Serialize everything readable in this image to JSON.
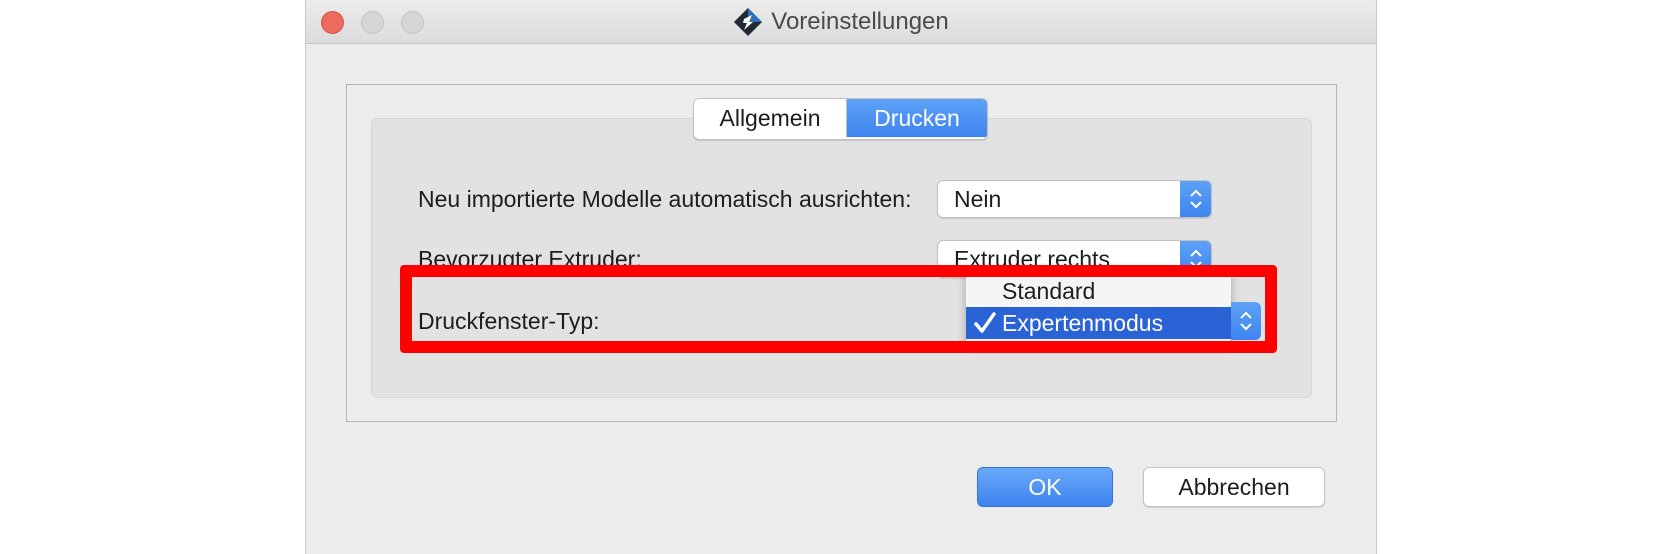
{
  "window": {
    "title": "Voreinstellungen"
  },
  "tabs": [
    {
      "label": "Allgemein",
      "selected": false
    },
    {
      "label": "Drucken",
      "selected": true
    }
  ],
  "settings": {
    "auto_align": {
      "label": "Neu importierte Modelle automatisch ausrichten:",
      "value": "Nein"
    },
    "extruder": {
      "label": "Bevorzugter Extruder:",
      "value": "Extruder rechts"
    },
    "window_type": {
      "label": "Druckfenster-Typ:",
      "options": [
        "Standard",
        "Expertenmodus"
      ],
      "selected": "Expertenmodus"
    }
  },
  "buttons": {
    "ok": "OK",
    "cancel": "Abbrechen"
  },
  "colors": {
    "accent": "#3d84ef",
    "highlight": "#ff0000",
    "menu_selection": "#2a63d6"
  }
}
